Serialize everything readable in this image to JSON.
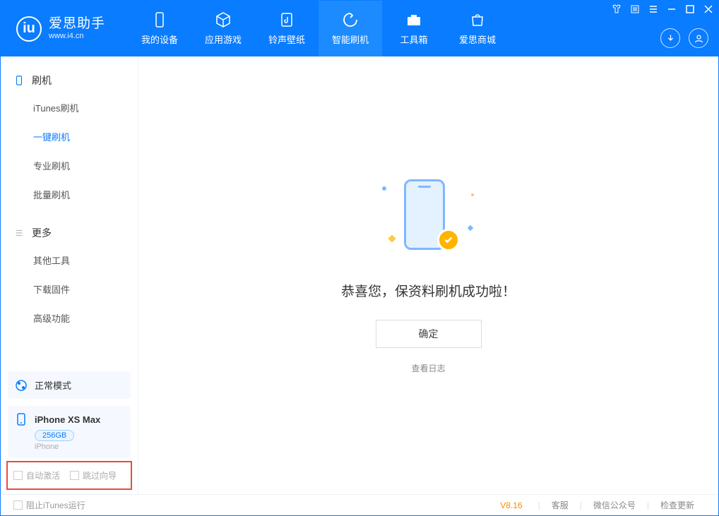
{
  "logo": {
    "title": "爱思助手",
    "subtitle": "www.i4.cn"
  },
  "tabs": [
    {
      "label": "我的设备"
    },
    {
      "label": "应用游戏"
    },
    {
      "label": "铃声壁纸"
    },
    {
      "label": "智能刷机"
    },
    {
      "label": "工具箱"
    },
    {
      "label": "爱思商城"
    }
  ],
  "sidebar": {
    "group1": {
      "title": "刷机",
      "items": [
        "iTunes刷机",
        "一键刷机",
        "专业刷机",
        "批量刷机"
      ]
    },
    "group2": {
      "title": "更多",
      "items": [
        "其他工具",
        "下载固件",
        "高级功能"
      ]
    }
  },
  "mode": {
    "label": "正常模式"
  },
  "device": {
    "name": "iPhone XS Max",
    "capacity": "256GB",
    "type": "iPhone"
  },
  "options": {
    "auto_activate": "自动激活",
    "skip_guide": "跳过向导"
  },
  "content": {
    "success": "恭喜您，保资料刷机成功啦！",
    "ok": "确定",
    "view_log": "查看日志"
  },
  "footer": {
    "block_itunes": "阻止iTunes运行",
    "version": "V8.16",
    "links": [
      "客服",
      "微信公众号",
      "检查更新"
    ]
  }
}
